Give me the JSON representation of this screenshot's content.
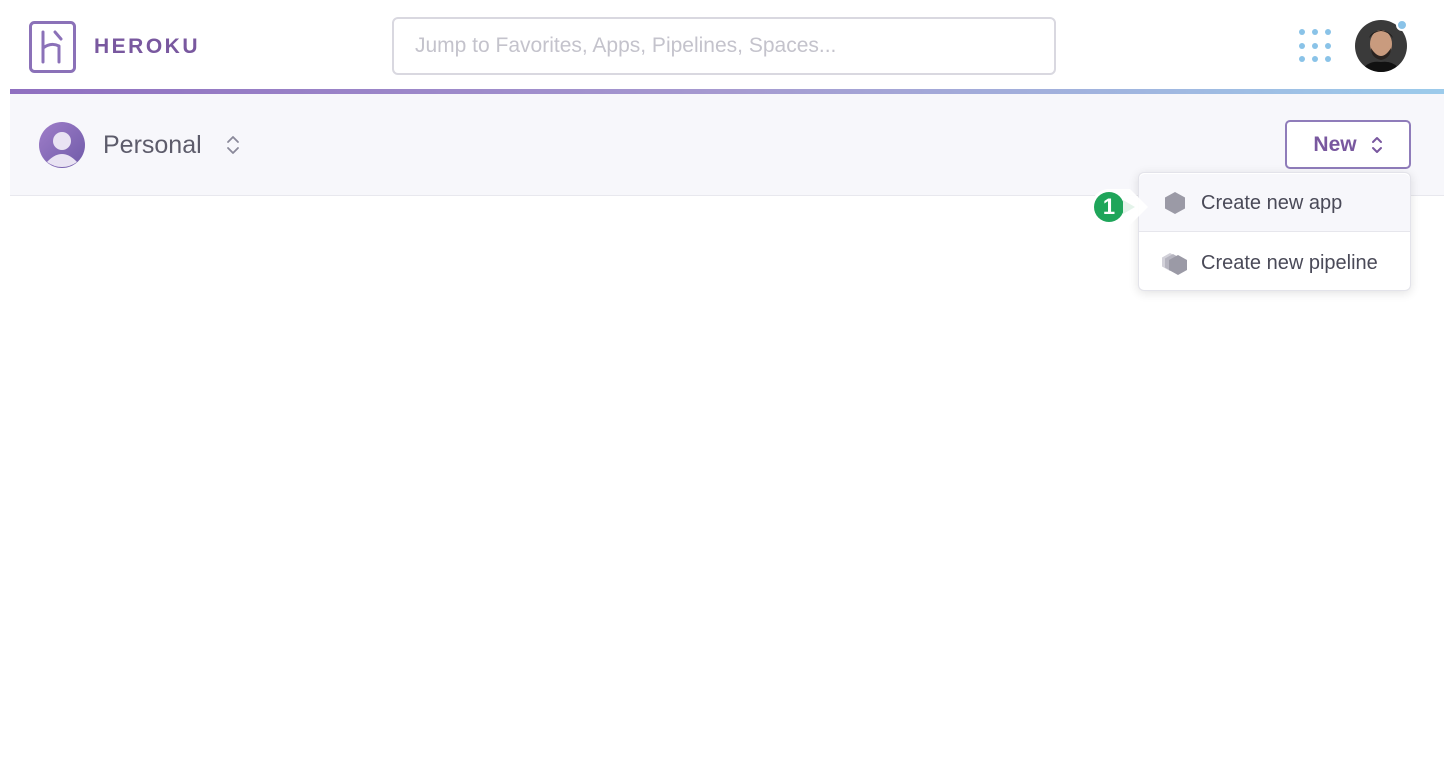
{
  "header": {
    "logo_text": "HEROKU",
    "search_placeholder": "Jump to Favorites, Apps, Pipelines, Spaces..."
  },
  "subheader": {
    "account_name": "Personal",
    "new_button_label": "New"
  },
  "new_menu": {
    "items": [
      {
        "label": "Create new app",
        "icon": "hexagon-app-icon"
      },
      {
        "label": "Create new pipeline",
        "icon": "pipeline-stack-icon"
      }
    ]
  },
  "annotation": {
    "step_number": "1",
    "badge_color": "#1fa55a"
  },
  "colors": {
    "brand_purple": "#79589f",
    "accent_blue": "#8ac3e8",
    "subheader_bg": "#f7f7fb"
  }
}
